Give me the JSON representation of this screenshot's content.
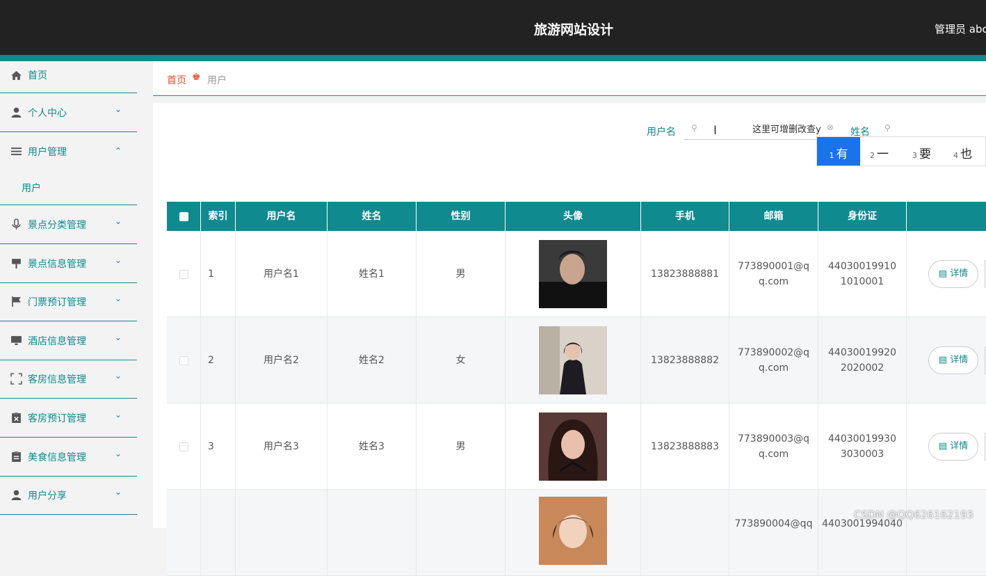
{
  "header": {
    "title": "旅游网站设计",
    "admin": "管理员 abc"
  },
  "sidebar": {
    "items": [
      {
        "label": "首页",
        "icon": "home-icon"
      },
      {
        "label": "个人中心",
        "icon": "user-icon"
      },
      {
        "label": "用户管理",
        "icon": "list-icon",
        "expanded": true
      },
      {
        "label": "景点分类管理",
        "icon": "mic-icon"
      },
      {
        "label": "景点信息管理",
        "icon": "sign-icon"
      },
      {
        "label": "门票预订管理",
        "icon": "flag-icon"
      },
      {
        "label": "酒店信息管理",
        "icon": "monitor-icon"
      },
      {
        "label": "客房信息管理",
        "icon": "frame-icon"
      },
      {
        "label": "客房预订管理",
        "icon": "clipboard-x-icon"
      },
      {
        "label": "美食信息管理",
        "icon": "clipboard-icon"
      },
      {
        "label": "用户分享",
        "icon": "user-icon"
      }
    ],
    "sub_item": "用户"
  },
  "breadcrumb": {
    "home": "首页",
    "current": "用户"
  },
  "search": {
    "username_label": "用户名",
    "username_value": "这里可增删改查y",
    "name_label": "姓名",
    "name_value": ""
  },
  "ime": {
    "candidates": [
      {
        "n": "1",
        "c": "有"
      },
      {
        "n": "2",
        "c": "一"
      },
      {
        "n": "3",
        "c": "要"
      },
      {
        "n": "4",
        "c": "也"
      }
    ]
  },
  "table": {
    "headers": [
      "索引",
      "用户名",
      "姓名",
      "性别",
      "头像",
      "手机",
      "邮箱",
      "身份证"
    ],
    "rows": [
      {
        "idx": "1",
        "username": "用户名1",
        "name": "姓名1",
        "gender": "男",
        "phone": "13823888881",
        "email": "773890001@qq.com",
        "id": "440300199101010001"
      },
      {
        "idx": "2",
        "username": "用户名2",
        "name": "姓名2",
        "gender": "女",
        "phone": "13823888882",
        "email": "773890002@qq.com",
        "id": "440300199202020002"
      },
      {
        "idx": "3",
        "username": "用户名3",
        "name": "姓名3",
        "gender": "男",
        "phone": "13823888883",
        "email": "773890003@qq.com",
        "id": "440300199303030003"
      },
      {
        "idx": "",
        "username": "",
        "name": "",
        "gender": "",
        "phone": "",
        "email": "773890004@qq",
        "id": "4403001994040"
      }
    ],
    "detail_label": "详情"
  },
  "watermark": "CSDN @QQ626162193",
  "colors": {
    "accent": "#0f8a8f",
    "header_bg": "#222222",
    "breadcrumb_home": "#e0502e",
    "ime_selected": "#1a73e8"
  }
}
